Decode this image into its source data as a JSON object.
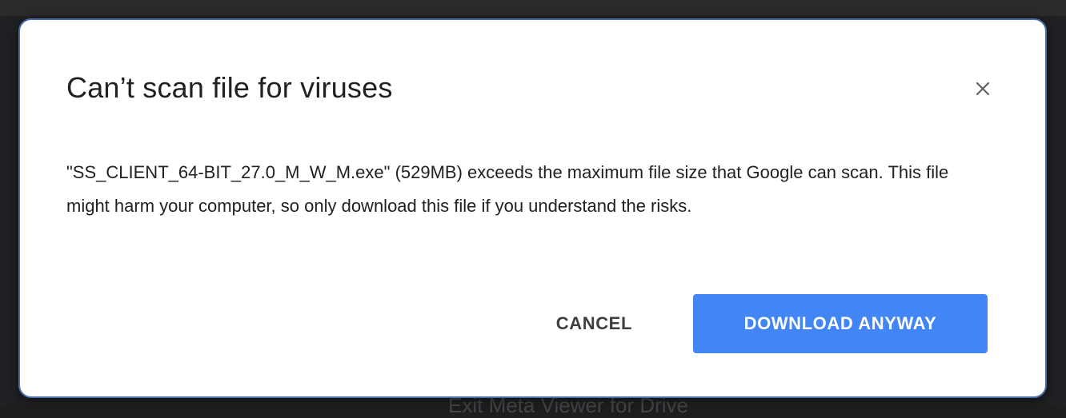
{
  "dialog": {
    "title": "Can’t scan file for viruses",
    "close_icon": "close-icon",
    "message": "\"SS_CLIENT_64-BIT_27.0_M_W_M.exe\" (529MB) exceeds the maximum file size that Google can scan. This file might harm your computer, so only download this file if you understand the risks.",
    "cancel_label": "CANCEL",
    "download_label": "DOWNLOAD ANYWAY"
  },
  "background": {
    "footer_text": "Exit Meta Viewer for Drive"
  },
  "colors": {
    "primary": "#4285f4",
    "text": "#202124",
    "dialog_bg": "#ffffff"
  }
}
